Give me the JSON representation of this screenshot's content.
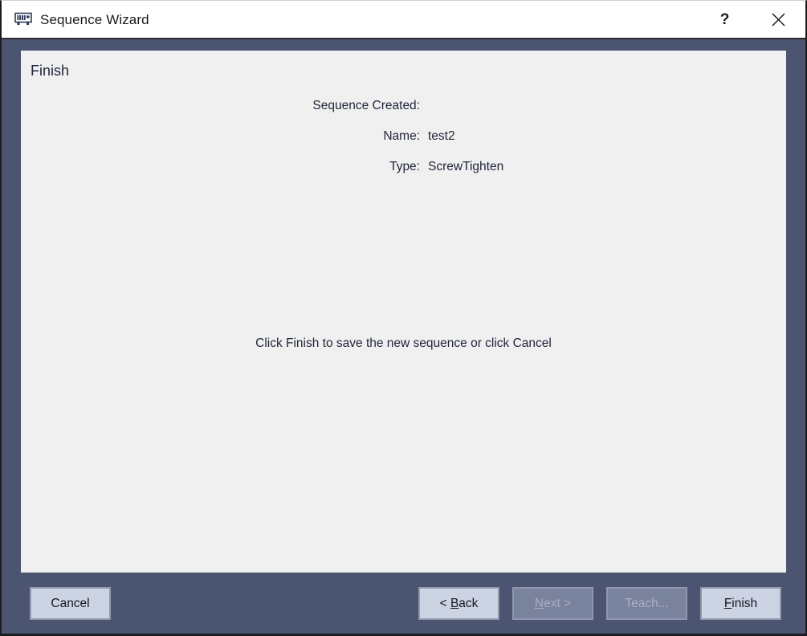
{
  "window": {
    "title": "Sequence Wizard",
    "icon": "memory-module-icon",
    "controls": [
      {
        "name": "help-button",
        "glyph": "?"
      },
      {
        "name": "close-button",
        "glyph": "×"
      }
    ]
  },
  "page": {
    "heading": "Finish",
    "summary_title": "Sequence Created:",
    "fields": [
      {
        "label": "Name:",
        "value": "test2"
      },
      {
        "label": "Type:",
        "value": "ScrewTighten"
      }
    ],
    "hint": "Click Finish to save the new sequence or click Cancel"
  },
  "footer": {
    "buttons": [
      {
        "name": "cancel-button",
        "label": "Cancel",
        "accel": "",
        "enabled": true
      },
      {
        "name": "back-button",
        "label": "< Back",
        "accel": "B",
        "enabled": true
      },
      {
        "name": "next-button",
        "label": "Next >",
        "accel": "N",
        "enabled": false
      },
      {
        "name": "teach-button",
        "label": "Teach...",
        "accel": "",
        "enabled": false
      },
      {
        "name": "finish-button",
        "label": "Finish",
        "accel": "F",
        "enabled": true
      }
    ]
  },
  "colors": {
    "frame": "#4b5572",
    "panel": "#f0f0f0",
    "titlebar": "#ffffff",
    "button_face": "#ccd3e3",
    "button_disabled": "#79839d",
    "text": "#20273a"
  }
}
